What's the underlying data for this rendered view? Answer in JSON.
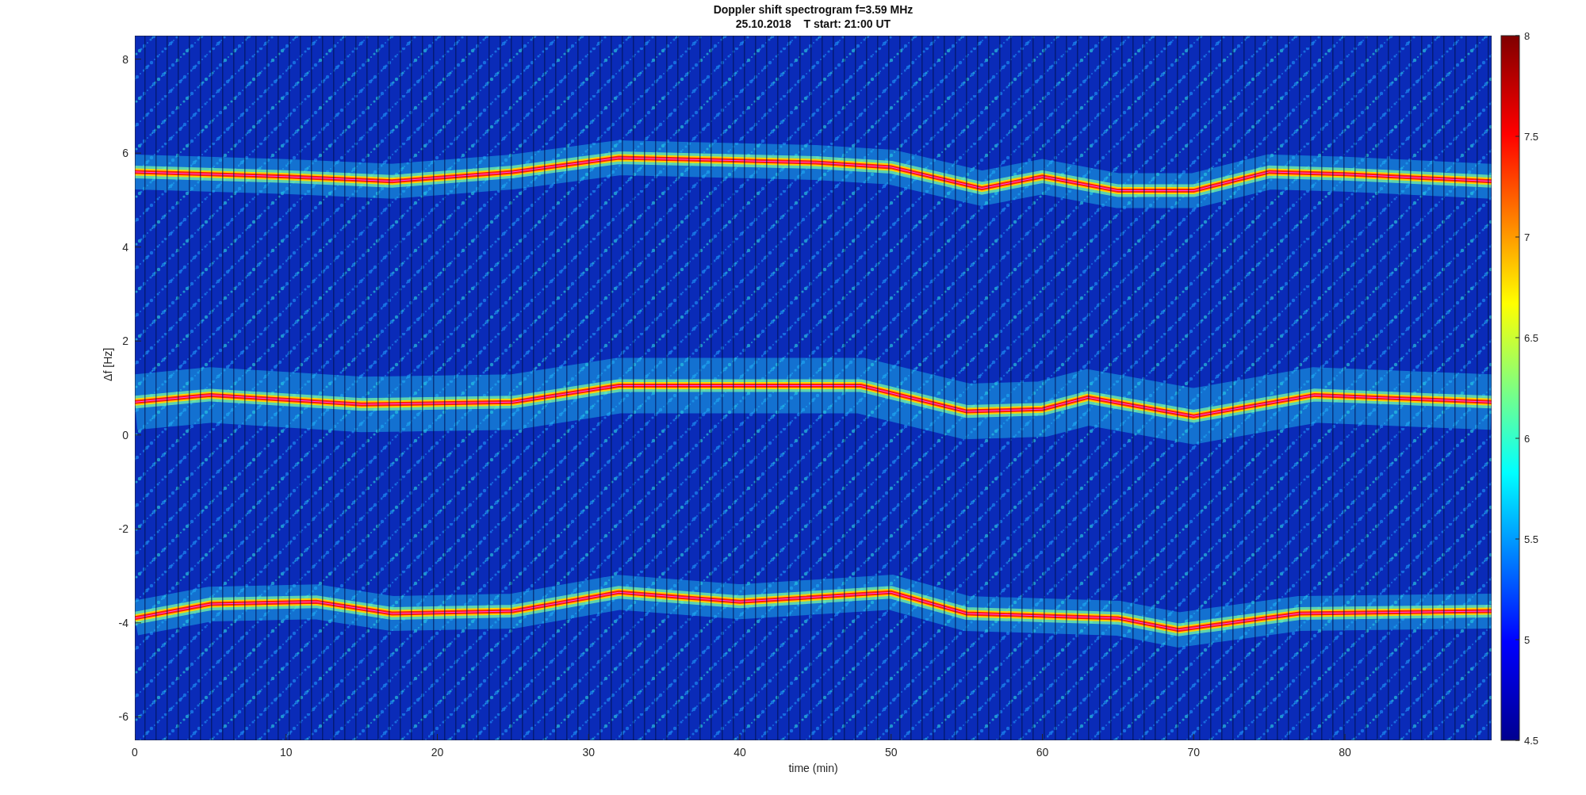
{
  "figure": {
    "title_lines": [
      "Doppler shift spectrogram f=3.59 MHz",
      "25.10.2018    T start: 21:00 UT"
    ],
    "xlabel": "time (min)",
    "ylabel": "Δf [Hz]",
    "xticks": [
      "0",
      "10",
      "20",
      "30",
      "40",
      "50",
      "60",
      "70",
      "80"
    ],
    "yticks": [
      "8",
      "6",
      "4",
      "2",
      "0",
      "-2",
      "-4",
      "-6"
    ],
    "colorbar_ticks": [
      "8",
      "7.5",
      "7",
      "6.5",
      "6",
      "5.5",
      "5",
      "4.5"
    ]
  }
}
